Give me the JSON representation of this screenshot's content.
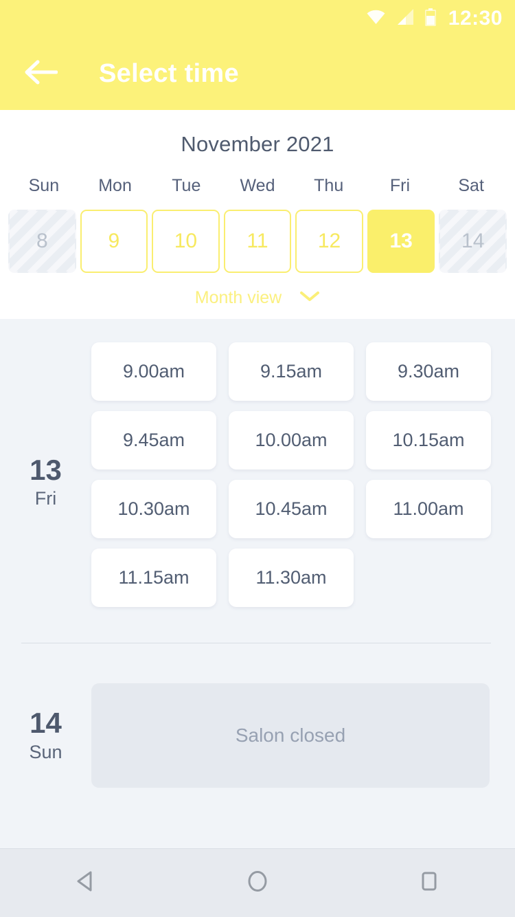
{
  "status_bar": {
    "time": "12:30",
    "icons": [
      "wifi-icon",
      "signal-icon",
      "battery-icon"
    ]
  },
  "app_bar": {
    "back_icon": "arrow-left-icon",
    "title": "Select time"
  },
  "calendar": {
    "month_title": "November 2021",
    "weekdays": [
      "Sun",
      "Mon",
      "Tue",
      "Wed",
      "Thu",
      "Fri",
      "Sat"
    ],
    "days": [
      {
        "number": "8",
        "state": "disabled"
      },
      {
        "number": "9",
        "state": "available"
      },
      {
        "number": "10",
        "state": "available"
      },
      {
        "number": "11",
        "state": "available"
      },
      {
        "number": "12",
        "state": "available"
      },
      {
        "number": "13",
        "state": "selected"
      },
      {
        "number": "14",
        "state": "disabled"
      }
    ],
    "month_view_label": "Month view",
    "month_view_icon": "chevron-down-icon"
  },
  "day_groups": [
    {
      "day_number": "13",
      "day_name": "Fri",
      "slots": [
        "9.00am",
        "9.15am",
        "9.30am",
        "9.45am",
        "10.00am",
        "10.15am",
        "10.30am",
        "10.45am",
        "11.00am",
        "11.15am",
        "11.30am"
      ]
    },
    {
      "day_number": "14",
      "day_name": "Sun",
      "closed_label": "Salon closed"
    }
  ],
  "nav_bar": {
    "back": "nav-back-icon",
    "home": "nav-home-icon",
    "recents": "nav-recents-icon"
  },
  "colors": {
    "accent_yellow": "#FCF27A",
    "selected_yellow": "#FAEF6B",
    "border_yellow": "#FAEE70",
    "text_dark": "#4F5A6E",
    "background": "#F1F4F8",
    "closed_panel": "#E5E9EF"
  }
}
